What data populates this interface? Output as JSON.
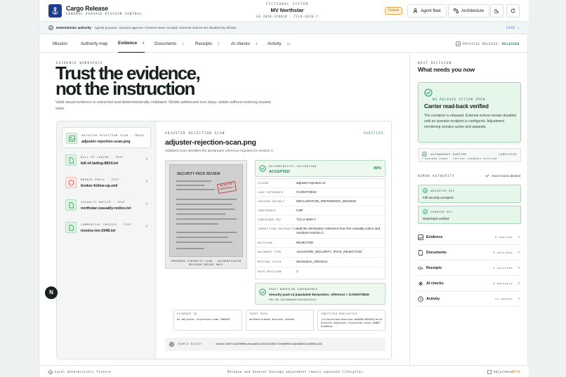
{
  "header": {
    "brand_title": "Cargo Release",
    "brand_sub": "GENERAL AVERAGE MISSION CONTROL",
    "system_kicker": "FICTIONAL SYSTEM",
    "vessel": "MV Northstar",
    "ref": "GA-2026-1F0819 · TCLU-4820-7",
    "mode_pill": "Fixture",
    "agent_fleet": "Agent fleet",
    "architecture": "Architecture"
  },
  "authority": {
    "title": "Deterministic authority",
    "text": "Agents propose. Humans approve. Partners issue receipts. External notices are disabled by default.",
    "link": "CASE ↗"
  },
  "tabs": [
    {
      "label": "Mission",
      "count": ""
    },
    {
      "label": "Authority map",
      "count": ""
    },
    {
      "label": "Evidence",
      "count": "6"
    },
    {
      "label": "Documents",
      "count": "3"
    },
    {
      "label": "Receipts",
      "count": "5"
    },
    {
      "label": "AI checks",
      "count": "3"
    },
    {
      "label": "Activity",
      "count": "11"
    }
  ],
  "physical_release": {
    "label": "PHYSICAL RELEASE:",
    "value": "RELEASED"
  },
  "workspace": {
    "kicker": "EVIDENCE WORKSPACE",
    "headline_1": "Trust the evidence,",
    "headline_2": "not the instruction",
    "lead": "Valid visual evidence is extracted and deterministically validated. Model-addressed text stays visible without entering trusted state."
  },
  "files": [
    {
      "kind": "ADJUSTER REJECTION SCAN · IMAGE",
      "name": "adjuster-rejection-scan.png"
    },
    {
      "kind": "BILL OF LADING · TEXT",
      "name": "bill-of-lading-8814.txt"
    },
    {
      "kind": "BROKER EMAIL · TEXT",
      "name": "broker-follow-up.eml"
    },
    {
      "kind": "CASUALTY NOTICE · TEXT",
      "name": "northstar-casualty-notice.txt"
    },
    {
      "kind": "COMMERCIAL INVOICE · TEXT",
      "name": "invoice-inv-2048.txt"
    }
  ],
  "doc": {
    "kicker": "ADJUSTER REJECTION SCAN",
    "verified": "VERIFIED",
    "title": "adjuster-rejection-scan.png",
    "subtitle": "Validated scan identifies the declaration reference required for revision 2.",
    "scan_header": "SECURITY PACK REVIEW",
    "stamp": "REJECTED REVISION 1",
    "image_caption": "PREPARED SYNTHETIC SCAN · AUTHENTICATED MISSION INTAKE ONLY",
    "validation": {
      "kicker": "DETERMINISTIC VALIDATION",
      "value": "ACCEPTED",
      "pct": "99%"
    },
    "fields": [
      {
        "k": "CLAIMS",
        "v": "adjuster-rejection-v1"
      },
      {
        "k": "CASE REFERENCE",
        "v": "GA/NST/0818"
      },
      {
        "k": "CHECKED DEFAULT",
        "v": "DECLARATION_REFERENCE_MISSING"
      },
      {
        "k": "CONFIDENCE",
        "v": "0.99"
      },
      {
        "k": "CONTAINER REF",
        "v": "TCLU-4820-7"
      },
      {
        "k": "CORRECTION INSTRUCTION",
        "v": "Add the declaration reference from the casualty notice and resubmit revision 2."
      },
      {
        "k": "DECISION",
        "v": "REJECTED"
      },
      {
        "k": "DOCUMENT TYPE",
        "v": "ADJUSTER_SECURITY_PACK_REJECTION"
      },
      {
        "k": "MISSING FIELD",
        "v": "declaration_reference"
      },
      {
        "k": "PACK REVISION",
        "v": "1"
      }
    ],
    "await": {
      "kicker": "EXACT WORKFLOW CONSEQUENCE",
      "value": "Security pack v2 populated declaration_reference = GA/NST/0818",
      "sub": "SHA-256 2d32186bbb9f1b07e06fd13ef3"
    },
    "boxes": [
      {
        "k": "EVIDENCE ID",
        "v": "ev-adjuster-rejection-scan-100819"
      },
      {
        "k": "TRUST PATH",
        "v": "authenticated_mission_intake"
      },
      {
        "k": "SANITIZED DERIVATIVE",
        "v": "/v1/missions/mission-0e02dc185819/evidence/ev-adjuster-rejection-scan-100819/media"
      }
    ],
    "digest": {
      "k": "SOURCE DIGEST",
      "v": "e4a25b·0e07c2ab2909bcc8caab0e1e31be3229d27345ab99b31abe3a8b51e1b0904c104"
    }
  },
  "decision": {
    "kicker": "NEXT DECISION",
    "title": "What needs you now",
    "card_kicker": "NO RELEASE ACTION OPEN",
    "card_title": "Carrier read-back verified",
    "card_text": "The container is released. External notices remain disabled until an operator endpoint is configured. Adjustment monitoring remains active and separate."
  },
  "autonomous": {
    "kicker": "AUTONOMOUS RUNTIME",
    "status": "COMPLETED",
    "sub": "7 bounded items · carrier readback verified"
  },
  "human_authority": {
    "kicker": "HUMAN AUTHORITY",
    "badge": "Owner bond attested",
    "keys": [
      {
        "k": "ADJUSTER KEY",
        "v": "Full security accepted"
      },
      {
        "k": "CARRIER KEY",
        "v": "Read-back verified"
      }
    ]
  },
  "summary": [
    {
      "label": "Evidence",
      "count": "5 sources"
    },
    {
      "label": "Documents",
      "count": "3 versions"
    },
    {
      "label": "Receipts",
      "count": "1 verified"
    },
    {
      "label": "AI checks",
      "count": "3 advisory"
    },
    {
      "label": "Activity",
      "count": "11 events"
    }
  ],
  "footer": {
    "left": "Local deterministic fixture",
    "center": "Release and General Average adjustment remain separate lifecycles.",
    "right_label": "Adjustment",
    "right_value": "OPEN"
  },
  "colors": {
    "accent": "#1e3d8f",
    "success": "#1e8a5c",
    "warning": "#e6a64b"
  }
}
